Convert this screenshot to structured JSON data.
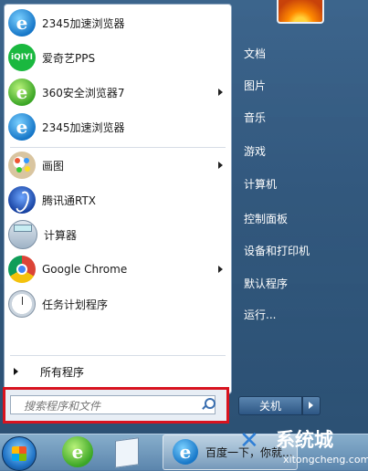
{
  "start_menu": {
    "programs": [
      {
        "label": "2345加速浏览器",
        "icon": "ie-2345-icon",
        "submenu": false
      },
      {
        "label": "爱奇艺PPS",
        "icon": "iqiyi-icon",
        "submenu": false
      },
      {
        "label": "360安全浏览器7",
        "icon": "360-browser-icon",
        "submenu": true
      },
      {
        "label": "2345加速浏览器",
        "icon": "ie-2345-icon",
        "submenu": false
      },
      {
        "label": "画图",
        "icon": "paint-icon",
        "submenu": true
      },
      {
        "label": "腾讯通RTX",
        "icon": "rtx-icon",
        "submenu": false
      },
      {
        "label": "计算器",
        "icon": "calculator-icon",
        "submenu": false
      },
      {
        "label": "Google Chrome",
        "icon": "chrome-icon",
        "submenu": true
      },
      {
        "label": "任务计划程序",
        "icon": "task-scheduler-icon",
        "submenu": false
      }
    ],
    "iqiyi_logo_text": "iQIYI",
    "all_programs": "所有程序",
    "search_placeholder": "搜索程序和文件",
    "right_items": [
      "文档",
      "图片",
      "音乐",
      "游戏",
      "计算机",
      "控制面板",
      "设备和打印机",
      "默认程序",
      "运行..."
    ],
    "shutdown_label": "关机"
  },
  "taskbar": {
    "active_window_label": "百度一下，你就..."
  },
  "watermark": {
    "mark": "✕",
    "text": "系统城",
    "sub": "xitongcheng.com"
  },
  "colors": {
    "highlight_border": "#d8131f",
    "accent": "#2f7fd6"
  }
}
